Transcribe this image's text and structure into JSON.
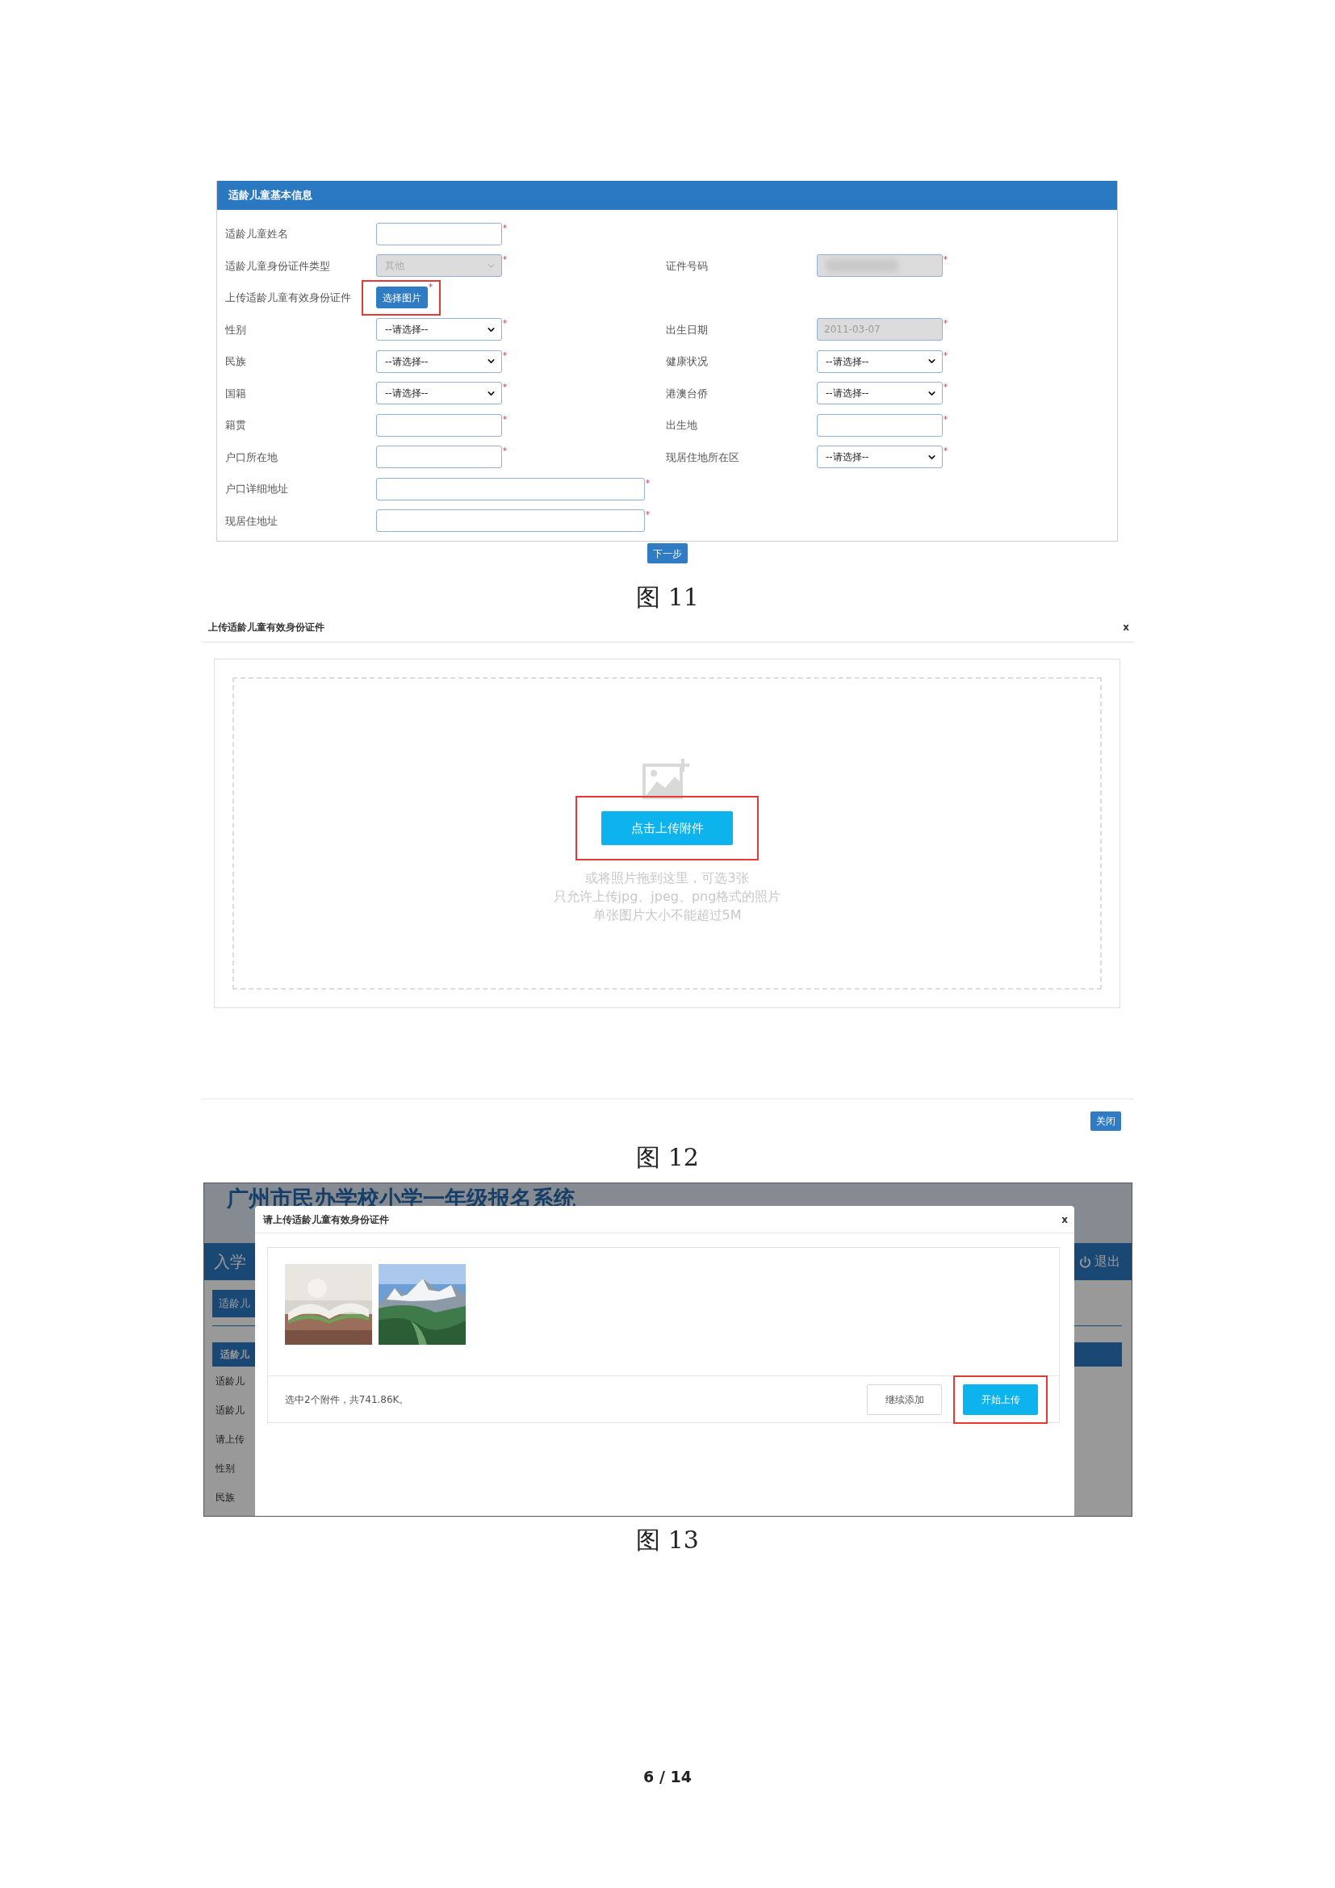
{
  "figure_11": {
    "panel_title": "适龄儿童基本信息",
    "rows": [
      {
        "left": {
          "label": "适龄儿童姓名",
          "kind": "input",
          "disabled": false,
          "masked": false,
          "wide": false,
          "suffix": "*"
        }
      },
      {
        "left": {
          "label": "适龄儿童身份证件类型",
          "kind": "select",
          "value": "其他",
          "disabled": true,
          "wide": false,
          "suffix": "*"
        },
        "right": {
          "label": "证件号码",
          "kind": "input",
          "disabled": true,
          "masked": true,
          "wide": false,
          "suffix": "*"
        }
      },
      {
        "left": {
          "label": "上传适龄儿童有效身份证件",
          "kind": "button",
          "value": "选择图片",
          "highlighted": true,
          "suffix": "*"
        }
      },
      {
        "left": {
          "label": "性别",
          "kind": "select",
          "value": "--请选择--",
          "disabled": false,
          "wide": false,
          "suffix": "*"
        },
        "right": {
          "label": "出生日期",
          "kind": "input",
          "value": "2011-03-07",
          "disabled": true,
          "masked": false,
          "wide": false,
          "suffix": "*"
        }
      },
      {
        "left": {
          "label": "民族",
          "kind": "select",
          "value": "--请选择--",
          "disabled": false,
          "wide": false,
          "suffix": "*"
        },
        "right": {
          "label": "健康状况",
          "kind": "select",
          "value": "--请选择--",
          "disabled": false,
          "wide": false,
          "suffix": "*"
        }
      },
      {
        "left": {
          "label": "国籍",
          "kind": "select",
          "value": "--请选择--",
          "disabled": false,
          "wide": false,
          "suffix": "*"
        },
        "right": {
          "label": "港澳台侨",
          "kind": "select",
          "value": "--请选择--",
          "disabled": false,
          "wide": false,
          "suffix": "*"
        }
      },
      {
        "left": {
          "label": "籍贯",
          "kind": "input",
          "disabled": false,
          "masked": false,
          "wide": false,
          "suffix": "*"
        },
        "right": {
          "label": "出生地",
          "kind": "input",
          "disabled": false,
          "masked": false,
          "wide": false,
          "suffix": "*"
        }
      },
      {
        "left": {
          "label": "户口所在地",
          "kind": "input",
          "disabled": false,
          "masked": false,
          "wide": false,
          "suffix": "*"
        },
        "right": {
          "label": "现居住地所在区",
          "kind": "select",
          "value": "--请选择--",
          "disabled": false,
          "wide": false,
          "suffix": "*"
        }
      },
      {
        "left": {
          "label": "户口详细地址",
          "kind": "input",
          "disabled": false,
          "masked": false,
          "wide": true,
          "suffix": "*"
        }
      },
      {
        "left": {
          "label": "现居住地址",
          "kind": "input",
          "disabled": false,
          "masked": false,
          "wide": true,
          "suffix": "*"
        }
      }
    ],
    "next_button": "下一步",
    "caption": "图 11"
  },
  "figure_12": {
    "title": "上传适龄儿童有效身份证件",
    "close": "x",
    "upload_button": {
      "label": "点击上传附件",
      "highlighted": true
    },
    "hints": [
      "或将照片拖到这里，可选3张",
      "只允许上传jpg、jpeg、png格式的照片",
      "单张图片大小不能超过5M"
    ],
    "footer_button": "关闭",
    "caption": "图 12"
  },
  "figure_13": {
    "background": {
      "site_title": "广州市民办学校小学一年级报名系统",
      "nav_left": "入学",
      "nav_right": "退出",
      "tab": "适龄儿",
      "panel_header": "适龄儿",
      "side_labels": [
        "适龄儿",
        "适龄儿",
        "请上传",
        "性别",
        "民族"
      ]
    },
    "modal": {
      "title": "请上传适龄儿童有效身份证件",
      "close": "x",
      "status": "选中2个附件，共741.86K。",
      "buttons": [
        {
          "label": "继续添加",
          "kind": "secondary",
          "highlighted": false
        },
        {
          "label": "开始上传",
          "kind": "primary",
          "highlighted": true
        }
      ]
    },
    "caption": "图 13"
  },
  "page_number": "6 / 14"
}
